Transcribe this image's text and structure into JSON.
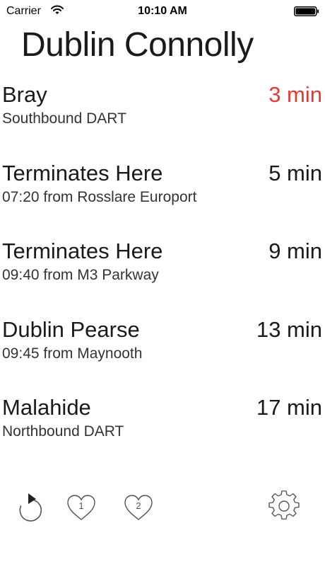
{
  "status_bar": {
    "carrier": "Carrier",
    "time": "10:10 AM",
    "wifi_icon": "wifi-icon",
    "battery_icon": "battery-icon"
  },
  "station": {
    "title": "Dublin Connolly"
  },
  "departures": [
    {
      "destination": "Bray",
      "detail": "Southbound DART",
      "due": "3 min",
      "highlight": true
    },
    {
      "destination": "Terminates Here",
      "detail": "07:20 from Rosslare Europort",
      "due": "5 min",
      "highlight": false
    },
    {
      "destination": "Terminates Here",
      "detail": "09:40 from M3 Parkway",
      "due": "9 min",
      "highlight": false
    },
    {
      "destination": "Dublin Pearse",
      "detail": "09:45 from Maynooth",
      "due": "13 min",
      "highlight": false
    },
    {
      "destination": "Malahide",
      "detail": "Northbound DART",
      "due": "17 min",
      "highlight": false
    }
  ],
  "toolbar": {
    "refresh_icon": "refresh-icon",
    "favorite_1_label": "1",
    "favorite_2_label": "2",
    "settings_icon": "gear-icon"
  },
  "colors": {
    "due_soon": "#e23a35",
    "text": "#1a1a1a",
    "icon": "#555555"
  }
}
